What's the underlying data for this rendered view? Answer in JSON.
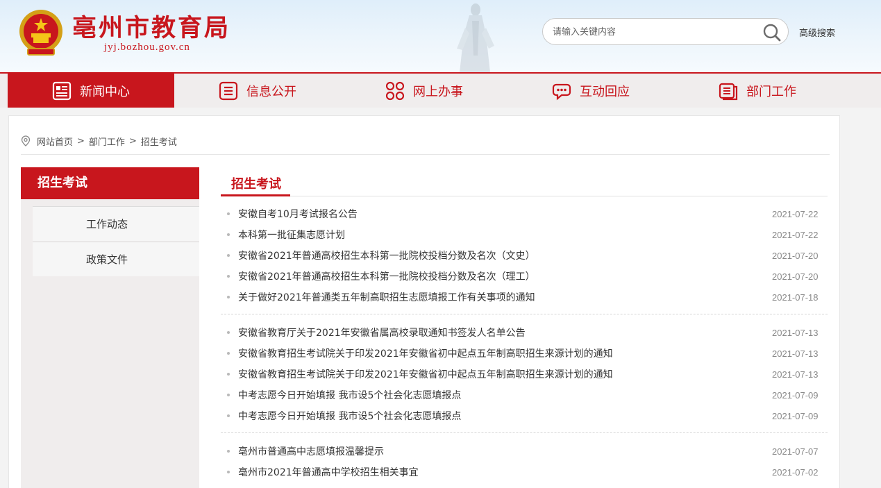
{
  "header": {
    "site_title": "亳州市教育局",
    "site_domain": "jyj.bozhou.gov.cn",
    "search_placeholder": "请输入关键内容",
    "advanced_search": "高级搜索"
  },
  "nav": {
    "items": [
      {
        "label": "新闻中心",
        "icon": "newspaper-icon"
      },
      {
        "label": "信息公开",
        "icon": "list-icon"
      },
      {
        "label": "网上办事",
        "icon": "grid-petal-icon"
      },
      {
        "label": "互动回应",
        "icon": "chat-icon"
      },
      {
        "label": "部门工作",
        "icon": "document-stack-icon"
      }
    ],
    "active": "新闻中心"
  },
  "breadcrumb": {
    "items": [
      "网站首页",
      "部门工作",
      "招生考试"
    ],
    "separator": ">"
  },
  "sidebar": {
    "title": "招生考试",
    "items": [
      "工作动态",
      "政策文件"
    ]
  },
  "main": {
    "title": "招生考试",
    "groups": [
      [
        {
          "title": "安徽自考10月考试报名公告",
          "date": "2021-07-22"
        },
        {
          "title": "本科第一批征集志愿计划",
          "date": "2021-07-22"
        },
        {
          "title": "安徽省2021年普通高校招生本科第一批院校投档分数及名次（文史）",
          "date": "2021-07-20"
        },
        {
          "title": "安徽省2021年普通高校招生本科第一批院校投档分数及名次（理工）",
          "date": "2021-07-20"
        },
        {
          "title": "关于做好2021年普通类五年制高职招生志愿填报工作有关事项的通知",
          "date": "2021-07-18"
        }
      ],
      [
        {
          "title": "安徽省教育厅关于2021年安徽省属高校录取通知书签发人名单公告",
          "date": "2021-07-13"
        },
        {
          "title": "安徽省教育招生考试院关于印发2021年安徽省初中起点五年制高职招生来源计划的通知",
          "date": "2021-07-13"
        },
        {
          "title": "安徽省教育招生考试院关于印发2021年安徽省初中起点五年制高职招生来源计划的通知",
          "date": "2021-07-13"
        },
        {
          "title": "中考志愿今日开始填报 我市设5个社会化志愿填报点",
          "date": "2021-07-09"
        },
        {
          "title": "中考志愿今日开始填报 我市设5个社会化志愿填报点",
          "date": "2021-07-09"
        }
      ],
      [
        {
          "title": "亳州市普通高中志愿填报温馨提示",
          "date": "2021-07-07"
        },
        {
          "title": "亳州市2021年普通高中学校招生相关事宜",
          "date": "2021-07-02"
        }
      ]
    ]
  },
  "colors": {
    "brand_red": "#c8161d",
    "nav_bg": "#f0eded",
    "header_bg": "#e6f1fb"
  }
}
